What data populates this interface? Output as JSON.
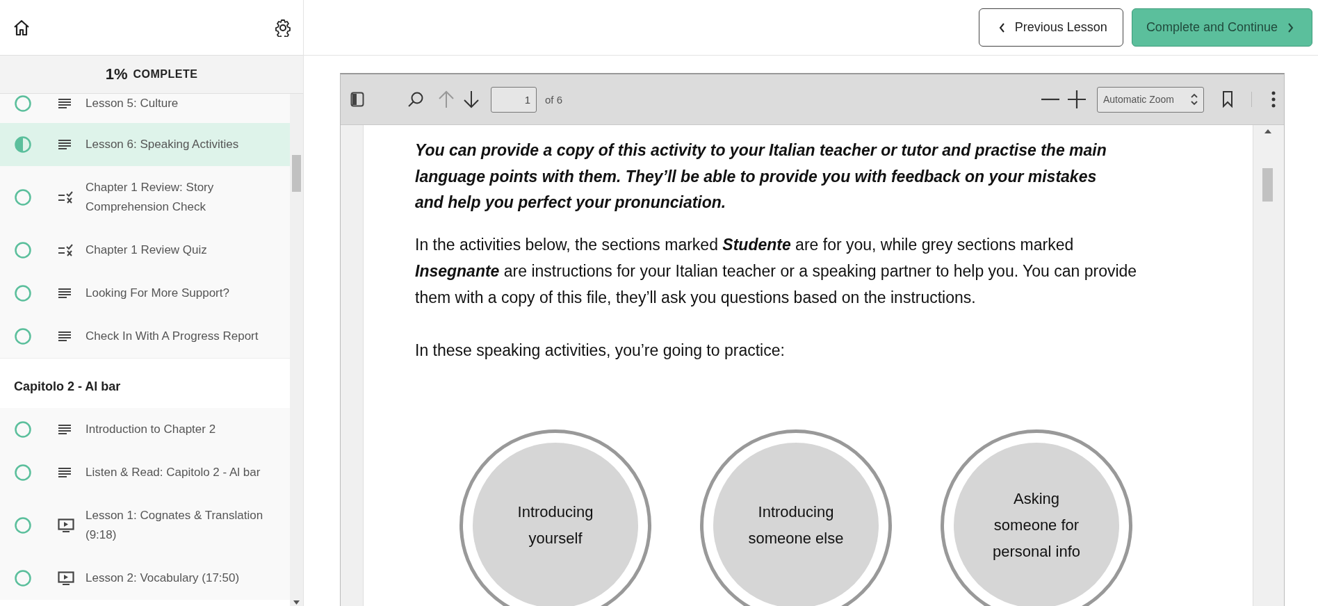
{
  "sidebar": {
    "progress": {
      "percent": "1%",
      "label": "COMPLETE"
    },
    "chapters": [
      {
        "lessons": [
          {
            "kind": "text",
            "title": "Lesson 5: Culture",
            "in_progress": false,
            "selected": false
          },
          {
            "kind": "text",
            "title": "Lesson 6: Speaking Activities",
            "in_progress": true,
            "selected": true
          },
          {
            "kind": "quiz",
            "title": "Chapter 1 Review: Story Comprehension Check",
            "in_progress": false,
            "selected": false
          },
          {
            "kind": "quiz",
            "title": "Chapter 1 Review Quiz",
            "in_progress": false,
            "selected": false
          },
          {
            "kind": "text",
            "title": "Looking For More Support?",
            "in_progress": false,
            "selected": false
          },
          {
            "kind": "text",
            "title": "Check In With A Progress Report",
            "in_progress": false,
            "selected": false
          }
        ]
      },
      {
        "title": "Capitolo 2 - Al bar",
        "lessons": [
          {
            "kind": "text",
            "title": "Introduction to Chapter 2",
            "in_progress": false,
            "selected": false
          },
          {
            "kind": "text",
            "title": "Listen & Read: Capitolo 2 - Al bar",
            "in_progress": false,
            "selected": false
          },
          {
            "kind": "video",
            "title": "Lesson 1: Cognates & Translation (9:18)",
            "in_progress": false,
            "selected": false
          },
          {
            "kind": "video",
            "title": "Lesson 2: Vocabulary (17:50)",
            "in_progress": false,
            "selected": false
          }
        ]
      }
    ]
  },
  "header": {
    "previous_button": "Previous Lesson",
    "complete_button": "Complete and Continue"
  },
  "pdf_viewer": {
    "toolbar": {
      "page": "1",
      "page_count": "of 6",
      "zoom": "Automatic Zoom"
    },
    "document": {
      "intro": "You can provide a copy of this activity to your Italian teacher or tutor and practise the main language points with them. They’ll be able to provide you with feedback on your mistakes and help you perfect your pronunciation.",
      "paragraphs": [
        "In the activities below, the sections marked **Studente** are for you, while grey sections marked **Insegnante** are instructions for your Italian teacher or a speaking partner to help you. You can provide them with a copy of this file, they’ll ask you questions based on the instructions.",
        "In these speaking activities, you’re going to practice:"
      ],
      "topics": [
        "Introducing yourself",
        "Introducing someone else",
        "Asking someone for personal info"
      ]
    }
  }
}
